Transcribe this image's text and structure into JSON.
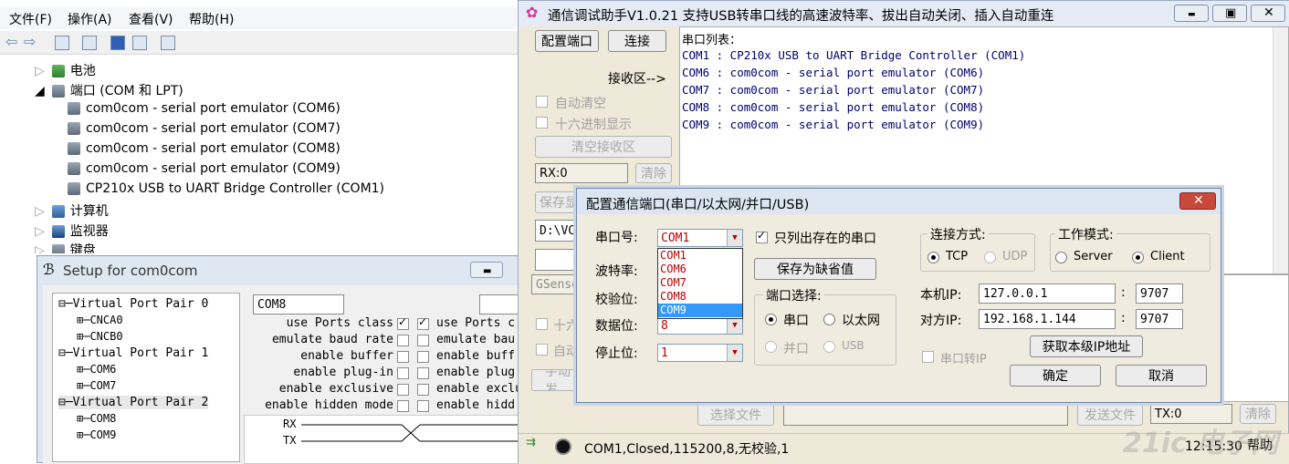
{
  "device_manager": {
    "menu": [
      "文件(F)",
      "操作(A)",
      "查看(V)",
      "帮助(H)"
    ],
    "tree": {
      "battery": "电池",
      "ports": "端口 (COM 和 LPT)",
      "port_items": [
        "com0com - serial port emulator (COM6)",
        "com0com - serial port emulator (COM7)",
        "com0com - serial port emulator (COM8)",
        "com0com - serial port emulator (COM9)",
        "CP210x USB to UART Bridge Controller (COM1)"
      ],
      "computer": "计算机",
      "monitor": "监视器",
      "keyboard": "键盘"
    }
  },
  "setup": {
    "title": "Setup for com0com",
    "tree": [
      {
        "pair": "Virtual Port Pair 0",
        "ports": [
          "CNCA0",
          "CNCB0"
        ]
      },
      {
        "pair": "Virtual Port Pair 1",
        "ports": [
          "COM6",
          "COM7"
        ]
      },
      {
        "pair": "Virtual Port Pair 2",
        "ports": [
          "COM8",
          "COM9"
        ]
      }
    ],
    "port_name": "COM8",
    "options": [
      "use Ports class",
      "emulate baud rate",
      "enable buffer",
      "enable plug-in",
      "enable exclusive",
      "enable hidden mode"
    ],
    "right_options": [
      "use Ports c",
      "emulate bau",
      "enable buff",
      "enable plug",
      "enable exclu",
      "enable hidd"
    ],
    "rx": "RX",
    "tx": "TX"
  },
  "assistant": {
    "title": "通信调试助手V1.0.21 支持USB转串口线的高速波特率、拔出自动关闭、插入自动重连",
    "config_port_btn": "配置端口",
    "connect_btn": "连接",
    "recv_area_label": "接收区-->",
    "auto_clear": "自动清空",
    "hex_display": "十六进制显示",
    "clear_recv_btn": "清空接收区",
    "rx_count": "RX:0",
    "clear_btn": "清除",
    "save_btn": "保存显",
    "path": "D:\\VC_",
    "gsensor": "GSenso",
    "hex_send_trunc": "十六",
    "auto_send_trunc": "自动",
    "manual_send_trunc": "手动发",
    "recv_lines": [
      "串口列表：",
      "COM1 : CP210x USB to UART Bridge Controller (COM1)",
      "COM6 : com0com - serial port emulator (COM6)",
      "COM7 : com0com - serial port emulator (COM7)",
      "COM8 : com0com - serial port emulator (COM8)",
      "COM9 : com0com - serial port emulator (COM9)"
    ],
    "select_file_btn": "选择文件",
    "send_file_btn": "发送文件",
    "tx_count": "TX:0",
    "clear_btn2": "清除",
    "status": "COM1,Closed,115200,8,无校验,1",
    "time": "12:15:30",
    "help": "帮助",
    "watermark": "21ic 电子网"
  },
  "dialog": {
    "title": "配置通信端口(串口/以太网/并口/USB)",
    "port_label": "串口号:",
    "port_value": "COM1",
    "port_options": [
      "COM1",
      "COM6",
      "COM7",
      "COM8",
      "COM9"
    ],
    "port_selected": "COM9",
    "baud_label": "波特率:",
    "parity_label": "校验位:",
    "databits_label": "数据位:",
    "databits_value": "8",
    "stopbits_label": "停止位:",
    "stopbits_value": "1",
    "only_existing": "只列出存在的串口",
    "save_default_btn": "保存为缺省值",
    "port_select_group": "端口选择:",
    "serial": "串口",
    "ethernet": "以太网",
    "parallel": "并口",
    "usb": "USB",
    "conn_type_group": "连接方式:",
    "tcp": "TCP",
    "udp": "UDP",
    "work_mode_group": "工作模式:",
    "server": "Server",
    "client": "Client",
    "local_ip_label": "本机IP:",
    "local_ip": "127.0.0.1",
    "local_port": "9707",
    "remote_ip_label": "对方IP:",
    "remote_ip": "192.168.1.144",
    "remote_port": "9707",
    "colon": ":",
    "serial_to_ip": "串口转IP",
    "get_ip_btn": "获取本级IP地址",
    "ok_btn": "确定",
    "cancel_btn": "取消"
  }
}
